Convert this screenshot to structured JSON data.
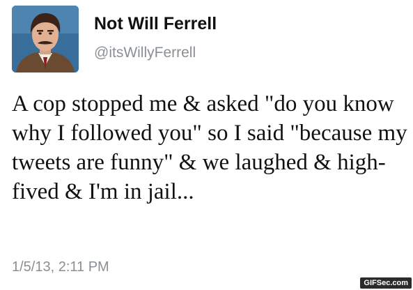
{
  "tweet": {
    "display_name": "Not Will Ferrell",
    "handle": "@itsWillyFerrell",
    "text": "A cop stopped me & asked \"do you know why I followed you\" so I said \"because my tweets are funny\" & we laughed & high-fived & I'm in jail...",
    "timestamp": "1/5/13, 2:11 PM"
  },
  "avatar": {
    "icon": "profile-photo",
    "background": "#3a6e9a"
  },
  "watermark": {
    "text": "GIFSec.com"
  },
  "colors": {
    "name": "#111111",
    "secondary": "#8a8f95",
    "background": "#ffffff"
  }
}
